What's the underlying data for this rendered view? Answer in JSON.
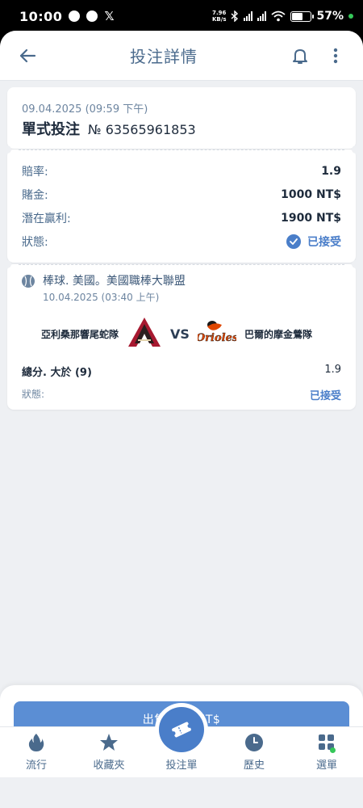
{
  "status_bar": {
    "time": "10:00",
    "speed_value": "7.96",
    "speed_unit": "KB/s",
    "battery": "57%"
  },
  "header": {
    "title": "投注詳情"
  },
  "bet": {
    "date": "09.04.2025 (09:59 下午)",
    "type": "單式投注",
    "id": "№ 63565961853"
  },
  "details": {
    "odds_label": "賠率:",
    "odds_value": "1.9",
    "stake_label": "賭金:",
    "stake_value": "1000 NT$",
    "payout_label": "潛在贏利:",
    "payout_value": "1900 NT$",
    "status_label": "狀態:",
    "status_value": "已接受"
  },
  "event": {
    "league": "棒球. 美國。美國職棒大聯盟",
    "time": "10.04.2025 (03:40 上午)",
    "home_team": "亞利桑那響尾蛇隊",
    "vs": "VS",
    "away_team": "巴爾的摩金鶯隊",
    "away_logo_text": "Orioles",
    "market": "總分. 大於 (9)",
    "market_odds": "1.9",
    "status_label": "狀態:",
    "status_value": "已接受"
  },
  "sell": {
    "label": "出售 940 NT$"
  },
  "nav": {
    "items": [
      {
        "label": "流行",
        "icon": "flame-icon"
      },
      {
        "label": "收藏夾",
        "icon": "star-icon"
      },
      {
        "label": "投注單",
        "icon": "ticket-icon"
      },
      {
        "label": "歷史",
        "icon": "clock-icon"
      },
      {
        "label": "選單",
        "icon": "grid-icon"
      }
    ]
  },
  "colors": {
    "accent": "#4a7ec9",
    "button": "#5b8ed4",
    "text_dark": "#1e2b3c",
    "text_muted": "#4a6a8c",
    "background": "#eef0f3"
  }
}
